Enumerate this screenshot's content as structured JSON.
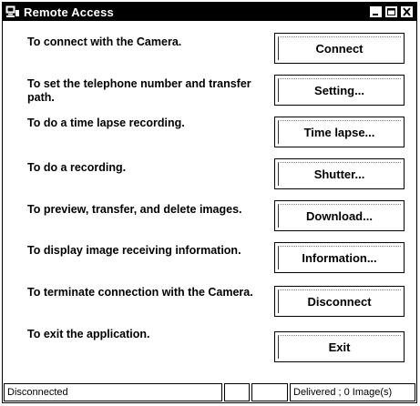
{
  "window": {
    "title": "Remote Access",
    "app_icon": "camera-computer-icon",
    "controls": {
      "minimize_icon": "minimize-icon",
      "maximize_icon": "maximize-icon",
      "close_icon": "close-icon"
    }
  },
  "rows": [
    {
      "id": "connect",
      "description": "To connect with the Camera.",
      "button_label": "Connect"
    },
    {
      "id": "setting",
      "description": "To set the telephone number and transfer path.",
      "button_label": "Setting..."
    },
    {
      "id": "time-lapse",
      "description": "To do a time lapse recording.",
      "button_label": "Time lapse..."
    },
    {
      "id": "shutter",
      "description": "To do a recording.",
      "button_label": "Shutter..."
    },
    {
      "id": "download",
      "description": "To preview, transfer, and delete images.",
      "button_label": "Download..."
    },
    {
      "id": "information",
      "description": "To display image receiving information.",
      "button_label": "Information..."
    },
    {
      "id": "disconnect",
      "description": "To terminate connection with the Camera.",
      "button_label": "Disconnect"
    },
    {
      "id": "exit",
      "description": "To exit the application.",
      "button_label": "Exit"
    }
  ],
  "statusbar": {
    "connection": "Disconnected",
    "pane2": "",
    "pane3": "",
    "delivered": "Delivered ; 0 Image(s)"
  },
  "colors": {
    "titlebar_bg": "#000000",
    "titlebar_text": "#ffffff",
    "window_bg": "#ffffff"
  }
}
